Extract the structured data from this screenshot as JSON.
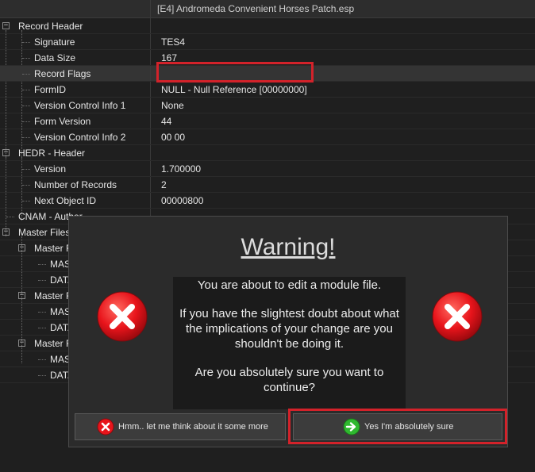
{
  "window": {
    "title": "[E4] Andromeda Convenient Horses Patch.esp"
  },
  "tree": [
    {
      "label": "Record Header",
      "value": ""
    },
    {
      "label": "Signature",
      "value": "TES4"
    },
    {
      "label": "Data Size",
      "value": "167"
    },
    {
      "label": "Record Flags",
      "value": ""
    },
    {
      "label": "FormID",
      "value": "NULL - Null Reference [00000000]"
    },
    {
      "label": "Version Control Info 1",
      "value": "None"
    },
    {
      "label": "Form Version",
      "value": "44"
    },
    {
      "label": "Version Control Info 2",
      "value": "00 00"
    },
    {
      "label": "HEDR - Header",
      "value": ""
    },
    {
      "label": "Version",
      "value": "1.700000"
    },
    {
      "label": "Number of Records",
      "value": "2"
    },
    {
      "label": "Next Object ID",
      "value": "00000800"
    },
    {
      "label": "CNAM - Author",
      "value": ""
    },
    {
      "label": "Master Files",
      "value": ""
    },
    {
      "label": "Master F",
      "value": ""
    },
    {
      "label": "MAS",
      "value": ""
    },
    {
      "label": "DATA",
      "value": ""
    },
    {
      "label": "Master F",
      "value": ""
    },
    {
      "label": "MAS",
      "value": ""
    },
    {
      "label": "DATA",
      "value": ""
    },
    {
      "label": "Master F",
      "value": ""
    },
    {
      "label": "MAS",
      "value": ""
    },
    {
      "label": "DATA",
      "value": ""
    }
  ],
  "dialog": {
    "title": "Warning!",
    "message": [
      "You are about to edit a module file.",
      "If you have the slightest doubt about what the implications of your change are you shouldn't be doing it.",
      "Are you absolutely sure you want to continue?"
    ],
    "cancel_label": "Hmm.. let me think about it some more",
    "confirm_label": "Yes I'm absolutely sure"
  },
  "colors": {
    "highlight": "#d3222a",
    "error_red": "#e8141b",
    "ok_green": "#2fb82f"
  }
}
